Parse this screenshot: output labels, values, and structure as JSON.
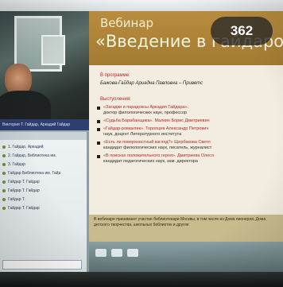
{
  "slide": {
    "kicker": "Вебинар",
    "title": "«Введение в гайдаровед",
    "program_label": "В программе:",
    "host": "Бажова-Гайдар Ариадна Павловна – Приветс",
    "speakers_label": "Выступления:",
    "talks": [
      {
        "title": "«Загадки и парадоксы Аркадия Гайдара».",
        "sub": "доктор филологических наук, профессор"
      },
      {
        "title": "«Судьба Барабанщика». Малкин Борис Дмитриевич",
        "sub": ""
      },
      {
        "title": "«Гайдар-романтик». Торопцев Александр Петрович",
        "sub": "наук, доцент Литературного института"
      },
      {
        "title": "«Есть ли поверхностный взгляд?» Щербакова Светл",
        "sub": "кандидат филологических наук, писатель, журналист"
      },
      {
        "title": "«В поисках положительного героя». Дмитриева Олеся",
        "sub": "кандидат педагогических наук, зам. директора"
      }
    ],
    "footer": "В вебинаре принимают участие библиотекари Москвы, в том числе из Дома пионеров, Дома детского творчества, школьных библиотек и другие"
  },
  "counter": "362",
  "video_caption": "Виктория Т. Гайдар, Аркадий Гайдар",
  "chat": {
    "items": [
      "1. Гайдар, Аркадий",
      "2. Гайдар, Библиотека им.",
      "3. Гайдар",
      "Гайдар Библиотека им. Гайд",
      "Гайдар Т. Гайдар",
      "Гайдар Т. Гайдар",
      "Гайдар Т.",
      "Гайдар Т. Гайдар"
    ]
  }
}
